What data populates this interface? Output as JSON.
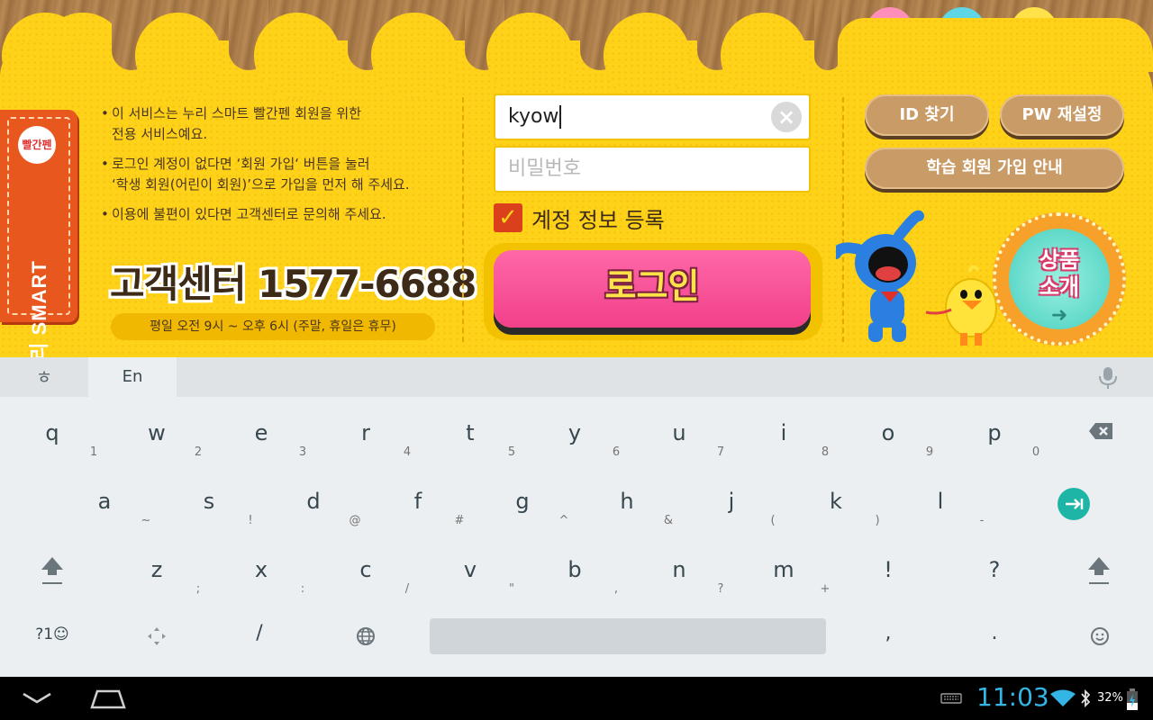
{
  "app": {
    "brand_tag": "누리 SMART",
    "brand_heart": "빨간펜",
    "info_bullets": [
      "이 서비스는 누리 스마트 빨간펜 회원을 위한\n전용 서비스예요.",
      "로그인 계정이 없다면 ‘회원 가입‘ 버튼을 눌러\n‘학생 회원(어린이 회원)’으로 가입을 먼저 해 주세요.",
      "이용에 불편이 있다면 고객센터로 문의해 주세요."
    ],
    "hotline": "고객센터 1577-6688",
    "hours": "평일 오전 9시 ~ 오후 6시 (주말, 휴일은 휴무)",
    "id_value": "kyow",
    "pw_placeholder": "비밀번호",
    "remember_label": "계정 정보 등록",
    "remember_checked": true,
    "login_label": "로그인",
    "find_id_label": "ID 찾기",
    "reset_pw_label": "PW 재설정",
    "signup_guide_label": "학습 회원 가입 안내",
    "product_badge_label_1": "상품",
    "product_badge_label_2": "소개",
    "colors": {
      "panel": "#ffd21a",
      "login_button": "#f2408a",
      "brown_button": "#c99b66",
      "tag": "#e8581e"
    }
  },
  "keyboard": {
    "lang_hangul": "ㅎ",
    "lang_en": "En",
    "row1": [
      {
        "k": "q",
        "s": "1"
      },
      {
        "k": "w",
        "s": "2"
      },
      {
        "k": "e",
        "s": "3"
      },
      {
        "k": "r",
        "s": "4"
      },
      {
        "k": "t",
        "s": "5"
      },
      {
        "k": "y",
        "s": "6"
      },
      {
        "k": "u",
        "s": "7"
      },
      {
        "k": "i",
        "s": "8"
      },
      {
        "k": "o",
        "s": "9"
      },
      {
        "k": "p",
        "s": "0"
      }
    ],
    "row2": [
      {
        "k": "a",
        "s": "~"
      },
      {
        "k": "s",
        "s": "!"
      },
      {
        "k": "d",
        "s": "@"
      },
      {
        "k": "f",
        "s": "#"
      },
      {
        "k": "g",
        "s": "^"
      },
      {
        "k": "h",
        "s": "&"
      },
      {
        "k": "j",
        "s": "("
      },
      {
        "k": "k",
        "s": ")"
      },
      {
        "k": "l",
        "s": "-"
      }
    ],
    "row3": [
      {
        "k": "z",
        "s": ";"
      },
      {
        "k": "x",
        "s": ":"
      },
      {
        "k": "c",
        "s": "/"
      },
      {
        "k": "v",
        "s": "\""
      },
      {
        "k": "b",
        "s": ","
      },
      {
        "k": "n",
        "s": "?"
      },
      {
        "k": "m",
        "s": "+"
      },
      {
        "k": "!",
        "s": ""
      },
      {
        "k": "?",
        "s": ""
      }
    ],
    "symbols_key": "?1☺",
    "slash_key": "/",
    "comma_key": ",",
    "period_key": "."
  },
  "status_bar": {
    "time": "11:03",
    "battery": "32%"
  }
}
